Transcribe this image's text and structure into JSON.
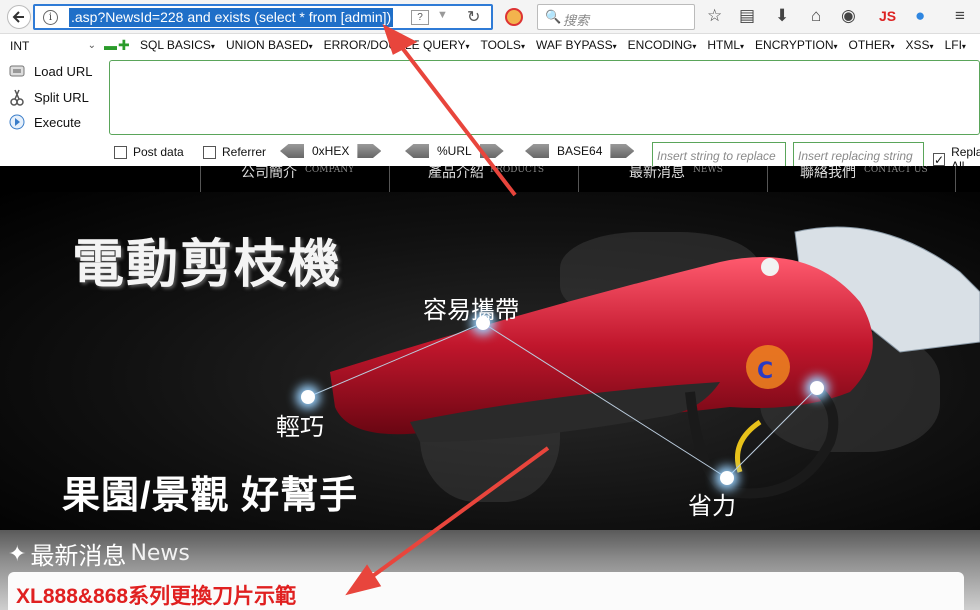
{
  "browser": {
    "url": ".asp?NewsId=228 and exists (select * from [admin])",
    "search_placeholder": "搜索",
    "js_label": "JS"
  },
  "hackbar": {
    "select_value": "INT",
    "menu": [
      "SQL BASICS",
      "UNION BASED",
      "ERROR/DOUBLE QUERY",
      "TOOLS",
      "WAF BYPASS",
      "ENCODING",
      "HTML",
      "ENCRYPTION",
      "OTHER",
      "XSS",
      "LFI"
    ],
    "load_url": "Load URL",
    "split_url": "Split URL",
    "execute": "Execute",
    "post_data": "Post data",
    "referrer": "Referrer",
    "hex": "0xHEX",
    "url_enc": "%URL",
    "base64": "BASE64",
    "find_placeholder": "Insert string to replace",
    "replace_placeholder": "Insert replacing string",
    "replace_all": "Replace All"
  },
  "site": {
    "nav": [
      {
        "zh": "公司簡介",
        "en": "COMPANY"
      },
      {
        "zh": "產品介紹",
        "en": "PRODUCTS"
      },
      {
        "zh": "最新消息",
        "en": "NEWS"
      },
      {
        "zh": "聯絡我們",
        "en": "CONTACT US"
      }
    ],
    "banner_title": "電動剪枝機",
    "label_carry": "容易攜帶",
    "label_light": "輕巧",
    "label_effort": "省力",
    "tagline": "果園/景觀 好幫手",
    "news_heading_zh": "最新消息",
    "news_heading_en": "News",
    "news_item": "XL888&868系列更換刀片示範"
  },
  "colors": {
    "url_highlight": "#1f6fc8",
    "hackbar_green": "#5aa55a",
    "news_red": "#e02020",
    "arrow_red": "#e8453c"
  }
}
